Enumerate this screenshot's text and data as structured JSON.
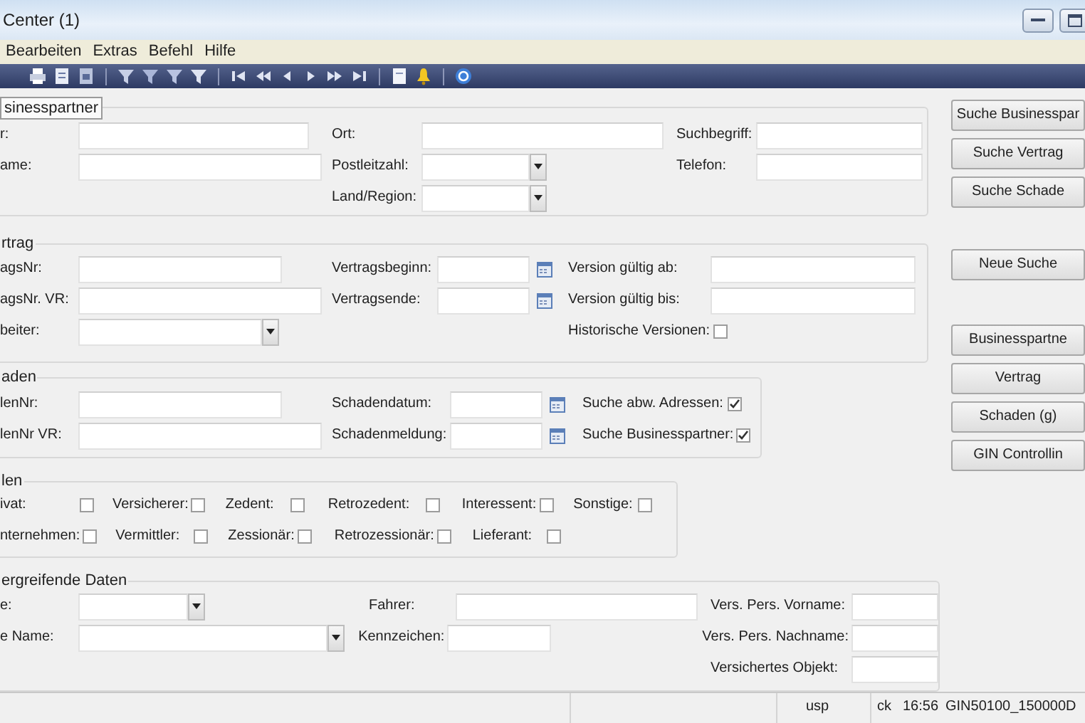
{
  "window": {
    "title": "Center (1)"
  },
  "menu": [
    "Bearbeiten",
    "Extras",
    "Befehl",
    "Hilfe"
  ],
  "groups": [
    {
      "legend": "sinesspartner",
      "focused": true,
      "rows": [
        [
          {
            "label": "r:",
            "kind": "text"
          },
          {
            "label": "Ort:",
            "kind": "text"
          },
          {
            "label": "Suchbegriff:",
            "kind": "text"
          }
        ],
        [
          {
            "label": "ame:",
            "kind": "text"
          },
          {
            "label": "Postleitzahl:",
            "kind": "combo"
          },
          {
            "label": "Telefon:",
            "kind": "text"
          }
        ],
        [
          "",
          {
            "label": "Land/Region:",
            "kind": "combo"
          }
        ]
      ]
    },
    {
      "legend": "rtrag",
      "focused": false,
      "rows": [
        [
          {
            "label": "agsNr:",
            "kind": "text"
          },
          {
            "label": "Vertragsbeginn:",
            "kind": "date"
          },
          {
            "label": "Version gültig ab:",
            "kind": "text"
          }
        ],
        [
          {
            "label": "agsNr. VR:",
            "kind": "text"
          },
          {
            "label": "Vertragsende:",
            "kind": "date"
          },
          {
            "label": "Version gültig bis:",
            "kind": "text"
          }
        ],
        [
          {
            "label": "beiter:",
            "kind": "combo"
          },
          "",
          {
            "label": "Historische Versionen:",
            "kind": "checkbox",
            "checked": false
          }
        ]
      ]
    },
    {
      "legend": "aden",
      "focused": false,
      "rows": [
        [
          {
            "label": "lenNr:",
            "kind": "text"
          },
          {
            "label": "Schadendatum:",
            "kind": "date"
          },
          {
            "label": "Suche abw. Adressen:",
            "kind": "checkbox",
            "checked": true
          }
        ],
        [
          {
            "label": "lenNr VR:",
            "kind": "text"
          },
          {
            "label": "Schadenmeldung:",
            "kind": "date"
          },
          {
            "label": "Suche Businesspartner:",
            "kind": "checkbox",
            "checked": true
          }
        ]
      ]
    },
    {
      "legend": "len",
      "focused": false,
      "rows": [
        [
          {
            "label": "ivat:",
            "kind": "checkbox",
            "checked": false
          },
          {
            "label": "Versicherer:",
            "kind": "checkbox",
            "checked": false
          },
          {
            "label": "Zedent:",
            "kind": "checkbox",
            "checked": false
          },
          {
            "label": "Retrozedent:",
            "kind": "checkbox",
            "checked": false
          },
          {
            "label": "Interessent:",
            "kind": "checkbox",
            "checked": false
          },
          {
            "label": "Sonstige:",
            "kind": "checkbox",
            "checked": false
          }
        ],
        [
          {
            "label": "nternehmen:",
            "kind": "checkbox",
            "checked": false
          },
          {
            "label": "Vermittler:",
            "kind": "checkbox",
            "checked": false
          },
          {
            "label": "Zessionär:",
            "kind": "checkbox",
            "checked": false
          },
          {
            "label": "Retrozessionär:",
            "kind": "checkbox",
            "checked": false
          },
          {
            "label": "Lieferant:",
            "kind": "checkbox",
            "checked": false
          }
        ]
      ]
    },
    {
      "legend": "ergreifende Daten",
      "focused": false,
      "rows": [
        [
          {
            "label": "e:",
            "kind": "combo"
          },
          {
            "label": "Fahrer:",
            "kind": "text"
          },
          {
            "label": "Vers. Pers. Vorname:",
            "kind": "text"
          }
        ],
        [
          {
            "label": "e Name:",
            "kind": "combo"
          },
          {
            "label": "Kennzeichen:",
            "kind": "text"
          },
          {
            "label": "Vers. Pers. Nachname:",
            "kind": "text"
          }
        ],
        [
          "",
          "",
          {
            "label": "Versichertes Objekt:",
            "kind": "text"
          }
        ]
      ]
    }
  ],
  "side_buttons": [
    "Suche Businesspar",
    "Suche Vertrag",
    "Suche Schade",
    "Neue Suche",
    "Businesspartne",
    "Vertrag",
    "Schaden (g)",
    "GIN Controllin"
  ],
  "status_bar": [
    "usp",
    "ck",
    "16:56",
    "GIN50100_150000D"
  ]
}
